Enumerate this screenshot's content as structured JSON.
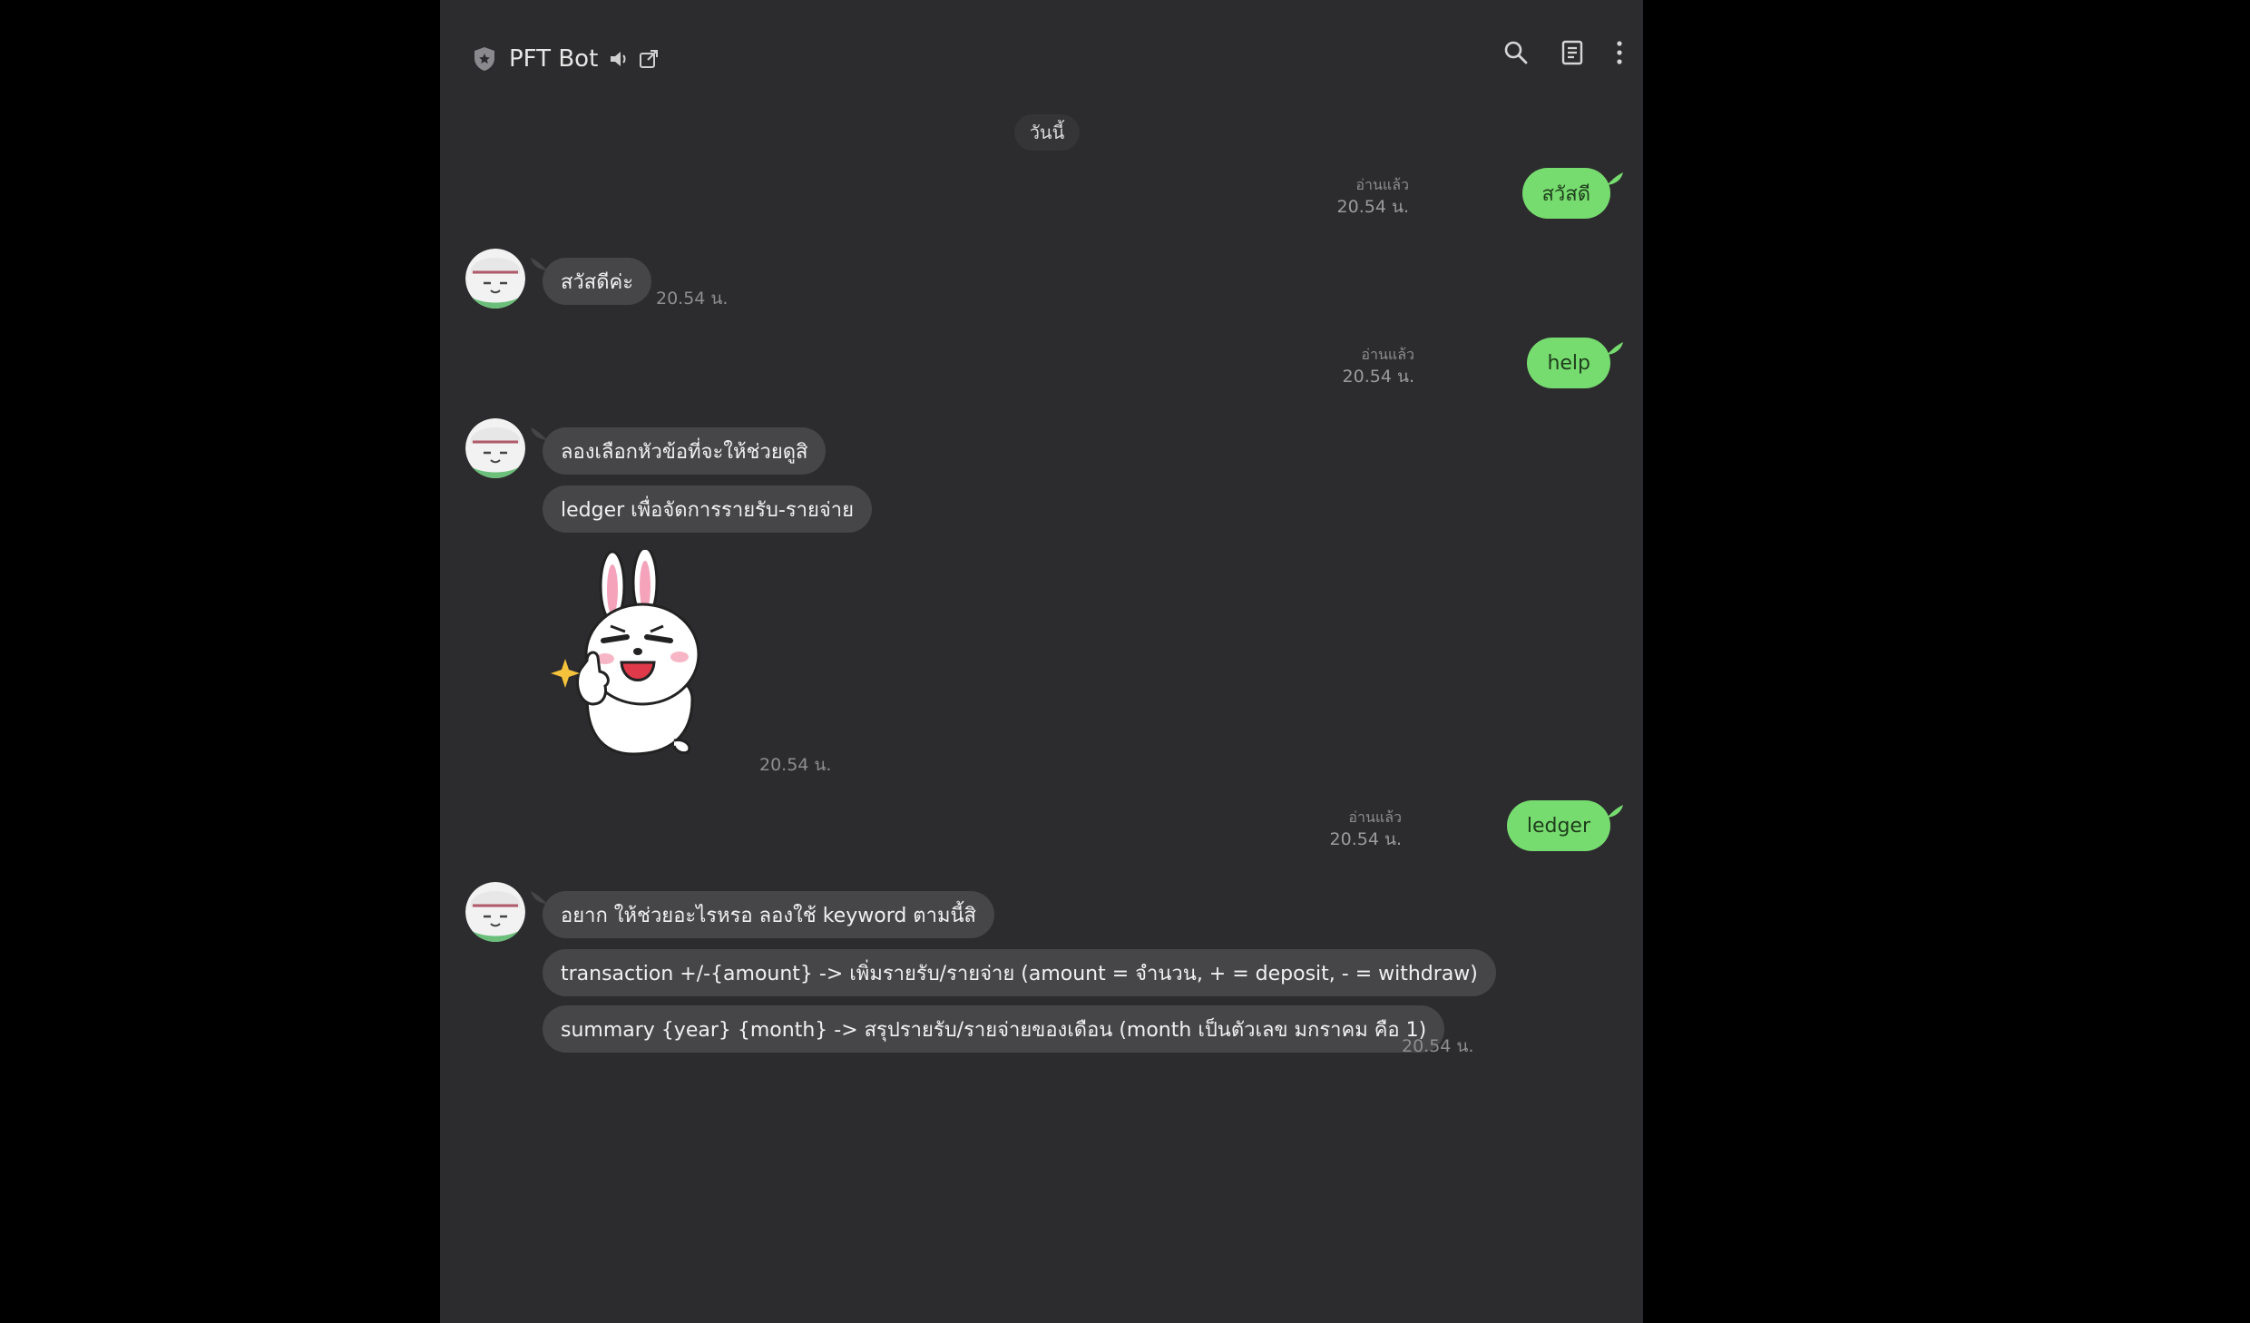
{
  "header": {
    "title": "PFT Bot",
    "icons": [
      "shield-icon",
      "speaker-icon",
      "external-link-icon",
      "search-icon",
      "note-icon",
      "more-icon"
    ]
  },
  "date_divider": "วันนี้",
  "messages": {
    "u1": {
      "text": "สวัสดี",
      "read": "อ่านแล้ว",
      "time": "20.54 น."
    },
    "b1": {
      "text": "สวัสดีค่ะ",
      "time": "20.54 น."
    },
    "u2": {
      "text": "help",
      "read": "อ่านแล้ว",
      "time": "20.54 น."
    },
    "b2": {
      "lines": [
        "ลองเลือกหัวข้อที่จะให้ช่วยดูสิ",
        "ledger เพื่อจัดการรายรับ-รายจ่าย"
      ],
      "sticker_time": "20.54 น."
    },
    "u3": {
      "text": "ledger",
      "read": "อ่านแล้ว",
      "time": "20.54 น."
    },
    "b3": {
      "lines": [
        "อยาก ให้ช่วยอะไรหรอ ลองใช้ keyword ตามนี้สิ",
        "transaction +/-{amount} -> เพิ่มรายรับ/รายจ่าย (amount = จำนวน, + = deposit, - = withdraw)",
        "summary {year} {month} -> สรุปรายรับ/รายจ่ายของเดือน (month เป็นตัวเลข มกราคม คือ 1)"
      ],
      "time": "20.54 น."
    }
  },
  "colors": {
    "app_bg": "#2c2c2e",
    "bot_bubble": "#464649",
    "user_bubble": "#77dc6f"
  }
}
